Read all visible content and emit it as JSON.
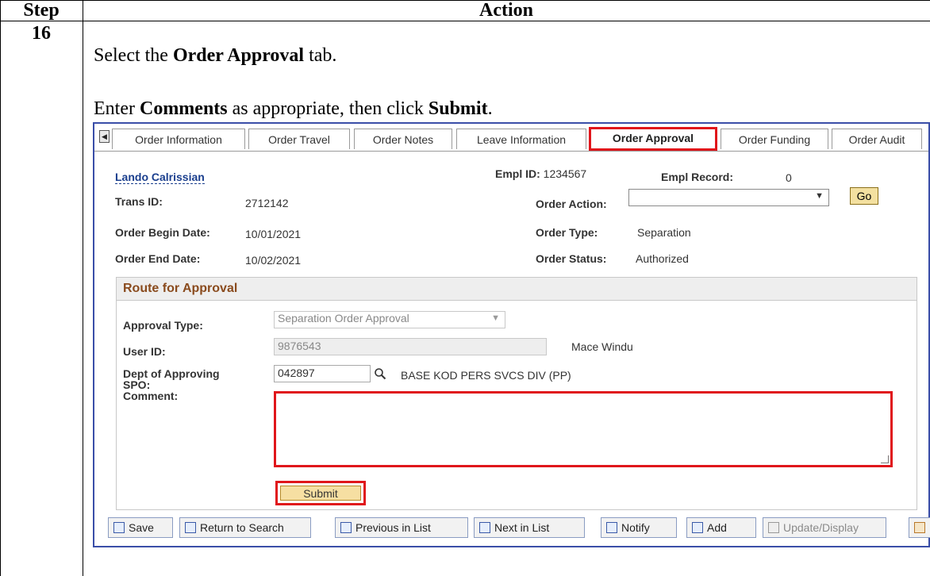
{
  "header": {
    "step": "Step",
    "action": "Action"
  },
  "row": {
    "step_number": "16"
  },
  "instructions": {
    "line1_pre": "Select the ",
    "line1_bold": "Order Approval",
    "line1_post": " tab.",
    "line2_pre": "Enter ",
    "line2_bold1": "Comments",
    "line2_mid": " as appropriate, then click ",
    "line2_bold2": "Submit",
    "line2_post": "."
  },
  "tabs": [
    {
      "label": "Order Information"
    },
    {
      "label": "Order Travel"
    },
    {
      "label": "Order Notes"
    },
    {
      "label": "Leave Information"
    },
    {
      "label": "Order Approval",
      "active": true
    },
    {
      "label": "Order Funding"
    },
    {
      "label": "Order Audit"
    }
  ],
  "employee": {
    "name": "Lando Calrissian",
    "empl_id_label": "Empl ID:",
    "empl_id": "1234567",
    "empl_record_label": "Empl Record:",
    "empl_record": "0",
    "trans_id_label": "Trans ID:",
    "trans_id": "2712142",
    "order_action_label": "Order Action:",
    "order_action_value": "",
    "go_label": "Go",
    "begin_label": "Order Begin Date:",
    "begin_date": "10/01/2021",
    "order_type_label": "Order Type:",
    "order_type": "Separation",
    "end_label": "Order End Date:",
    "end_date": "10/02/2021",
    "order_status_label": "Order Status:",
    "order_status": "Authorized"
  },
  "route": {
    "title": "Route for Approval",
    "approval_type_label": "Approval Type:",
    "approval_type_value": "Separation Order Approval",
    "user_id_label": "User ID:",
    "user_id": "9876543",
    "user_name": "Mace Windu",
    "dept_label_1": "Dept of Approving",
    "dept_label_2": "SPO:",
    "dept_value": "042897",
    "dept_desc": "BASE KOD PERS SVCS DIV (PP)",
    "comment_label": "Comment:",
    "comment_value": "",
    "submit_label": "Submit"
  },
  "toolbar": {
    "save": "Save",
    "return_to_search": "Return to Search",
    "previous_in_list": "Previous in List",
    "next_in_list": "Next in List",
    "notify": "Notify",
    "add": "Add",
    "update_display": "Update/Display"
  },
  "colors": {
    "highlight": "#e0161b",
    "link": "#1b3f8e",
    "panel_border": "#3a4ea8",
    "group_title": "#8a4b1e"
  }
}
